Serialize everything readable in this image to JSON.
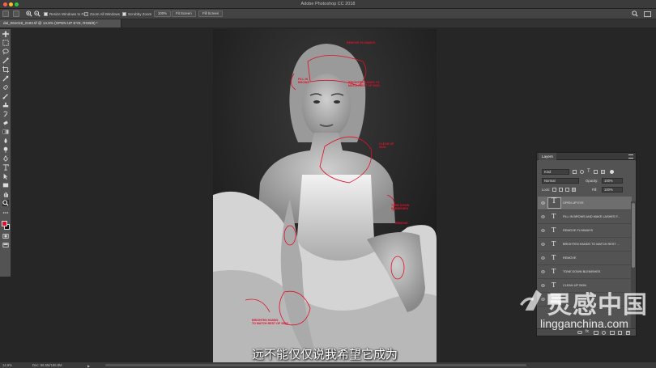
{
  "window": {
    "title": "Adobe Photoshop CC 2018",
    "traffic_colors": [
      "#fc5f57",
      "#fdbc2e",
      "#28c840"
    ]
  },
  "options_bar": {
    "resize_windows": "Resize Windows to Fit",
    "zoom_all": "Zoom All Windows",
    "scrubby_zoom": "Scrubby Zoom",
    "zoom_level": "100%",
    "fit_screen": "Fit Screen",
    "fill_screen": "Fill Screen"
  },
  "document_tab": {
    "label": "dal_061018_2193.tif @ 14.6% (OPEN UP EYE, RGB/8) *"
  },
  "canvas_annotations": [
    "REMOVE FLYAWAYS",
    "FILL IN\nBROWS",
    "BRIGHTEN HANDS TO\nMATCH REST OF SKIN",
    "CLEAN UP\nSKIN",
    "TONE DOWN\nBLEMISHES",
    "REMOVE",
    "BRIGHTEN HANDS\nTO MATCH REST OF SKIN"
  ],
  "layers_panel": {
    "tab": "Layers",
    "filter_kind": "Kind",
    "blend_mode": "Normal",
    "opacity_label": "Opacity:",
    "opacity_value": "100%",
    "lock_label": "Lock:",
    "fill_label": "Fill:",
    "fill_value": "100%",
    "layers": [
      {
        "name": "OPEN UP EYE",
        "active": true
      },
      {
        "name": "FILL IN BROWS AND MAKE LASHES F...",
        "active": false
      },
      {
        "name": "REMOVE FLYAWAYS",
        "active": false
      },
      {
        "name": "BRIGHTEN HANDS TO MATCH REST ...",
        "active": false
      },
      {
        "name": "REMOVE",
        "active": false
      },
      {
        "name": "TONE DOWN BLEMISHES",
        "active": false
      },
      {
        "name": "CLEAN UP SKIN",
        "active": false
      }
    ]
  },
  "status_bar": {
    "zoom": "14.6%",
    "doc": "Doc: 86.5M/186.8M"
  },
  "subtitle": "远不能仅仅说我希望它成为",
  "watermark": {
    "cn": "灵感中国",
    "en": "lingganchina.com"
  },
  "colors": {
    "accent_red": "#e0102a",
    "panel_bg": "#535353",
    "app_bg": "#262626"
  }
}
